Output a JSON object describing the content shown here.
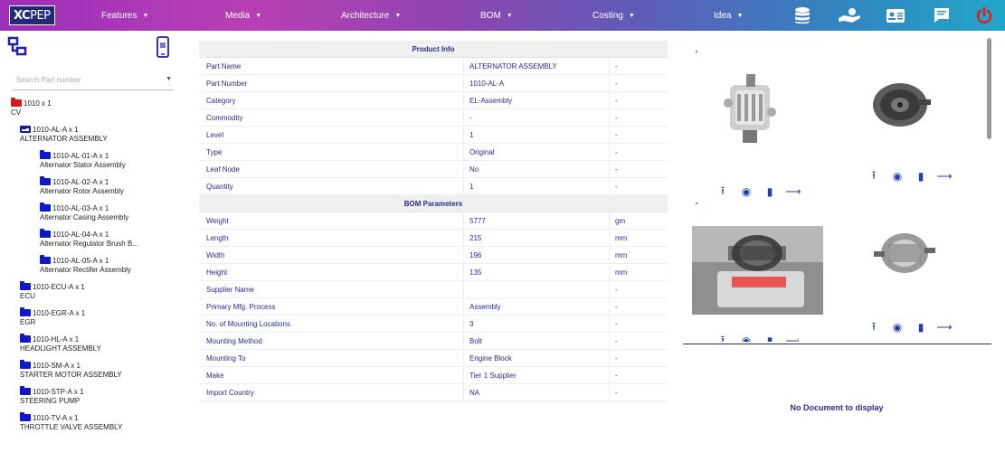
{
  "topbar": {
    "logo": {
      "prefix": "XC",
      "suffix": "PEP"
    },
    "menus": [
      {
        "label": "Features"
      },
      {
        "label": "Media"
      },
      {
        "label": "Architecture"
      },
      {
        "label": "BOM"
      },
      {
        "label": "Costing"
      },
      {
        "label": "Idea"
      }
    ],
    "icons": [
      "database-icon",
      "hand-coin-icon",
      "id-card-icon",
      "chat-icon",
      "power-icon"
    ]
  },
  "sidebar": {
    "search_placeholder": "Search Part number",
    "tree": [
      {
        "code": "1010 x 1",
        "name": "CV",
        "level": 0,
        "folder": "red"
      },
      {
        "code": "1010-AL-A x 1",
        "name": "ALTERNATOR ASSEMBLY",
        "level": 1,
        "folder": "open"
      },
      {
        "code": "1010-AL-01-A x 1",
        "name": "Alternator Stator Assembly",
        "level": 2,
        "folder": "closed"
      },
      {
        "code": "1010-AL-02-A x 1",
        "name": "Alternator Rotor Assembly",
        "level": 2,
        "folder": "closed"
      },
      {
        "code": "1010-AL-03-A x 1",
        "name": "Alternator Casing Assembly",
        "level": 2,
        "folder": "closed"
      },
      {
        "code": "1010-AL-04-A x 1",
        "name": "Alternator Regulator Brush B...",
        "level": 2,
        "folder": "closed"
      },
      {
        "code": "1010-AL-05-A x 1",
        "name": "Alternator Rectifer Assembly",
        "level": 2,
        "folder": "closed"
      },
      {
        "code": "1010-ECU-A x 1",
        "name": "ECU",
        "level": 1,
        "folder": "closed"
      },
      {
        "code": "1010-EGR-A x 1",
        "name": "EGR",
        "level": 1,
        "folder": "closed"
      },
      {
        "code": "1010-HL-A x 1",
        "name": "HEADLIGHT ASSEMBLY",
        "level": 1,
        "folder": "closed"
      },
      {
        "code": "1010-SM-A x 1",
        "name": "STARTER MOTOR ASSEMBLY",
        "level": 1,
        "folder": "closed"
      },
      {
        "code": "1010-STP-A x 1",
        "name": "STEERING PUMP",
        "level": 1,
        "folder": "closed"
      },
      {
        "code": "1010-TV-A x 1",
        "name": "THROTTLE VALVE ASSEMBLY",
        "level": 1,
        "folder": "closed"
      }
    ]
  },
  "product_info": {
    "title": "Product Info",
    "rows": [
      {
        "label": "Part Name",
        "value": "ALTERNATOR ASSEMBLY",
        "unit": "-"
      },
      {
        "label": "Part Number",
        "value": "1010-AL-A",
        "unit": "-"
      },
      {
        "label": "Category",
        "value": "EL-Assembly",
        "unit": "-"
      },
      {
        "label": "Commodity",
        "value": "-",
        "unit": "-"
      },
      {
        "label": "Level",
        "value": "1",
        "unit": "-"
      },
      {
        "label": "Type",
        "value": "Original",
        "unit": "-"
      },
      {
        "label": "Leaf Node",
        "value": "No",
        "unit": "-"
      },
      {
        "label": "Quantity",
        "value": "1",
        "unit": "-"
      }
    ]
  },
  "bom_parameters": {
    "title": "BOM Parameters",
    "rows": [
      {
        "label": "Weight",
        "value": "5777",
        "unit": "gm"
      },
      {
        "label": "Length",
        "value": "215",
        "unit": "mm"
      },
      {
        "label": "Width",
        "value": "196",
        "unit": "mm"
      },
      {
        "label": "Height",
        "value": "135",
        "unit": "mm"
      },
      {
        "label": "Supplier Name",
        "value": "",
        "unit": "-"
      },
      {
        "label": "Primary Mfg. Process",
        "value": "Assembly",
        "unit": "-"
      },
      {
        "label": "No. of Mounting Locations",
        "value": "3",
        "unit": "-"
      },
      {
        "label": "Mounting Method",
        "value": "Bolt",
        "unit": "-"
      },
      {
        "label": "Mounting To",
        "value": "Engine Block",
        "unit": "-"
      },
      {
        "label": "Make",
        "value": "Tier 1 Supplier",
        "unit": "-"
      },
      {
        "label": "Import Country",
        "value": "NA",
        "unit": "-"
      }
    ]
  },
  "documents": {
    "empty_message": "No Document to display"
  }
}
